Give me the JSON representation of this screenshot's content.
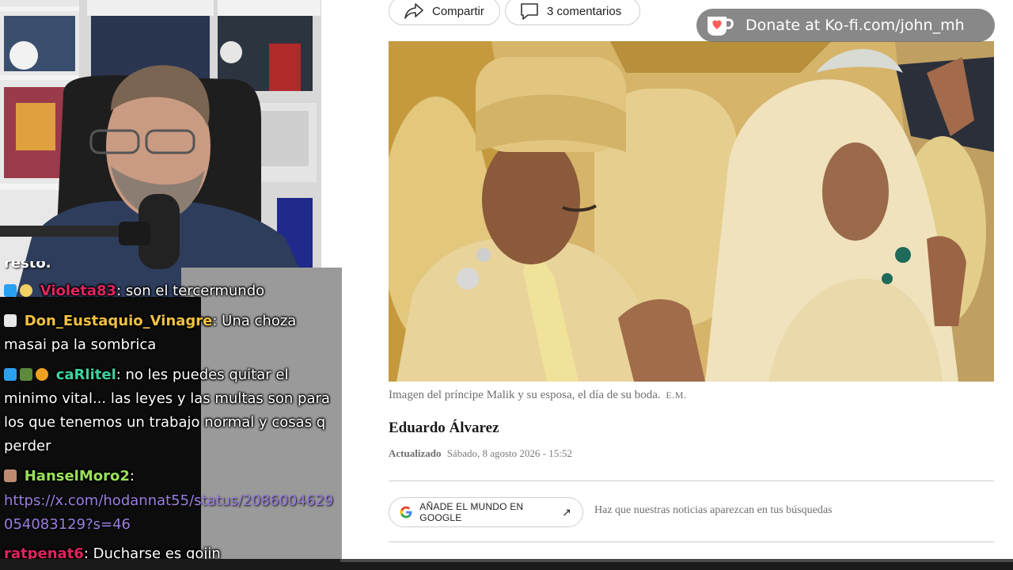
{
  "article": {
    "share_label": "Compartir",
    "comments_label": "3 comentarios",
    "caption_text": "Imagen del príncipe Malik y su esposa, el día de su boda.",
    "caption_credit": "E.M.",
    "author": "Eduardo Álvarez",
    "updated_label": "Actualizado",
    "updated_value": "Sábado, 8 agosto 2026 - 15:52",
    "google_button_label": "AÑADE EL MUNDO EN GOOGLE",
    "google_hint": "Haz que nuestras noticias aparezcan en tus búsquedas"
  },
  "donate": {
    "text": "Donate at Ko-fi.com/john_mh"
  },
  "chat": {
    "top_fragment": "resto.",
    "messages": [
      {
        "user": "Violeta83",
        "color": "#e0245e",
        "text": ": son el tercermundo"
      },
      {
        "user": "Don_Eustaquio_Vinagre",
        "color": "#f0c040",
        "text": ": Una choza masai pa la sombrica"
      },
      {
        "user": "caRlitel",
        "color": "#3cd3a0",
        "text": ": no les puedes quitar el minimo vital... las leyes y las multas son para los que tenemos un trabajo normal y cosas q perder"
      },
      {
        "user": "HanselMoro2",
        "color": "#9ae05a",
        "text": ":"
      },
      {
        "user": "",
        "color": "#ffffff",
        "link": "https://x.com/hodannat55/status/2086004629054083129?s=46",
        "text": ""
      },
      {
        "user": "ratpenat6",
        "color": "#e0245e",
        "text": ": Ducharse es gojin"
      }
    ]
  },
  "colors": {
    "article_text": "#1a1a1a",
    "muted_text": "#6f6f6f",
    "donate_bg": "#6e6e6e",
    "kofi_red": "#ff5e5b",
    "chat_link": "#9b7de0"
  },
  "icons": {
    "share": "share-arrow-icon",
    "comments": "speech-bubble-icon",
    "google": "google-g-icon",
    "external": "arrow-up-right-icon",
    "kofi": "kofi-cup-icon"
  }
}
